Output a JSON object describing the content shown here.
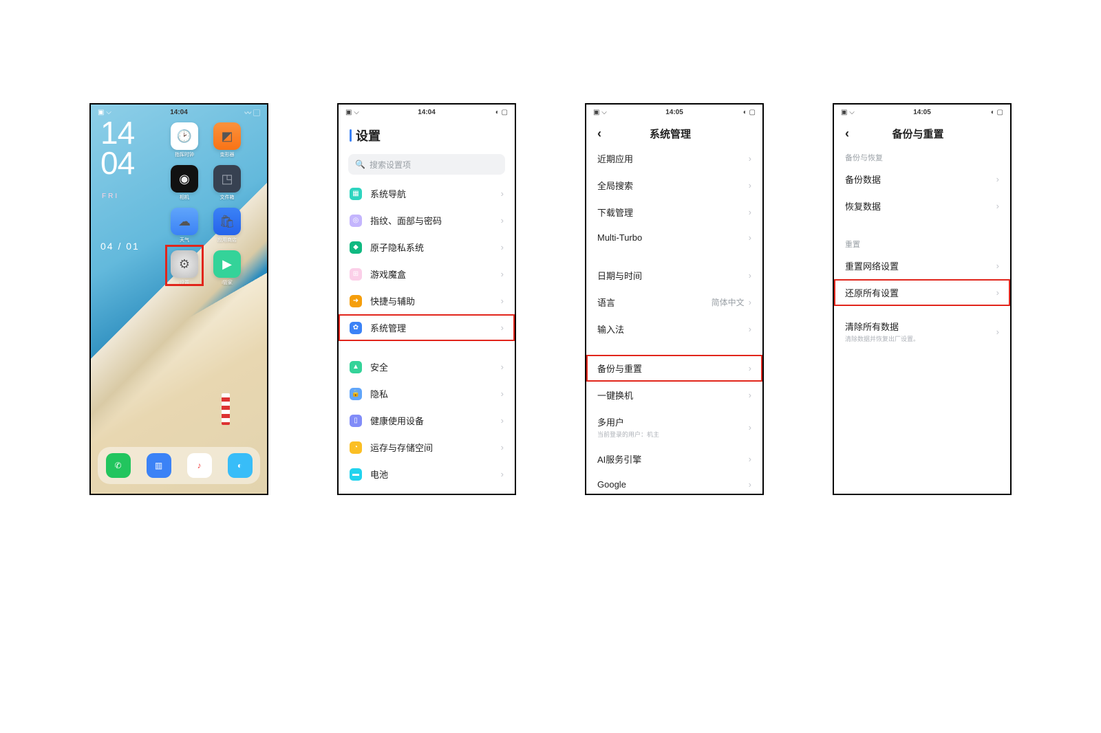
{
  "screen1": {
    "status_time": "14:04",
    "clock_h": "14",
    "clock_m": "04",
    "day": "FRI",
    "date": "04 / 01",
    "apps": {
      "r1c1": "指挥时钟",
      "r1c2": "变形器",
      "r2c1": "相机",
      "r2c2": "文件箱",
      "r3c1": "天气",
      "r3c2": "应用商店",
      "r4c1": "设置",
      "r4c2": "i管家"
    }
  },
  "screen2": {
    "status_time": "14:04",
    "title": "设置",
    "search_placeholder": "搜索设置项",
    "rows": {
      "nav": "系统导航",
      "fingerprint": "指纹、面部与密码",
      "privacy_atom": "原子隐私系统",
      "gamebox": "游戏魔盒",
      "shortcut": "快捷与辅助",
      "sys_mgmt": "系统管理",
      "security": "安全",
      "privacy": "隐私",
      "health": "健康使用设备",
      "storage": "运存与存储空间",
      "battery": "电池"
    }
  },
  "screen3": {
    "status_time": "14:05",
    "title": "系统管理",
    "rows": {
      "recent": "近期应用",
      "search": "全局搜索",
      "download": "下载管理",
      "multi": "Multi-Turbo",
      "datetime": "日期与时间",
      "lang": "语言",
      "lang_val": "简体中文",
      "ime": "输入法",
      "backup": "备份与重置",
      "clone": "一键换机",
      "multiuser": "多用户",
      "multiuser_sub": "当前登录的用户：机主",
      "ai": "AI服务引擎",
      "google": "Google"
    }
  },
  "screen4": {
    "status_time": "14:05",
    "title": "备份与重置",
    "section_backup": "备份与恢复",
    "section_reset": "重置",
    "rows": {
      "backup_data": "备份数据",
      "restore_data": "恢复数据",
      "reset_network": "重置网络设置",
      "reset_all": "还原所有设置",
      "erase_all": "清除所有数据",
      "erase_all_sub": "清除数据并恢复出厂设置。"
    }
  }
}
